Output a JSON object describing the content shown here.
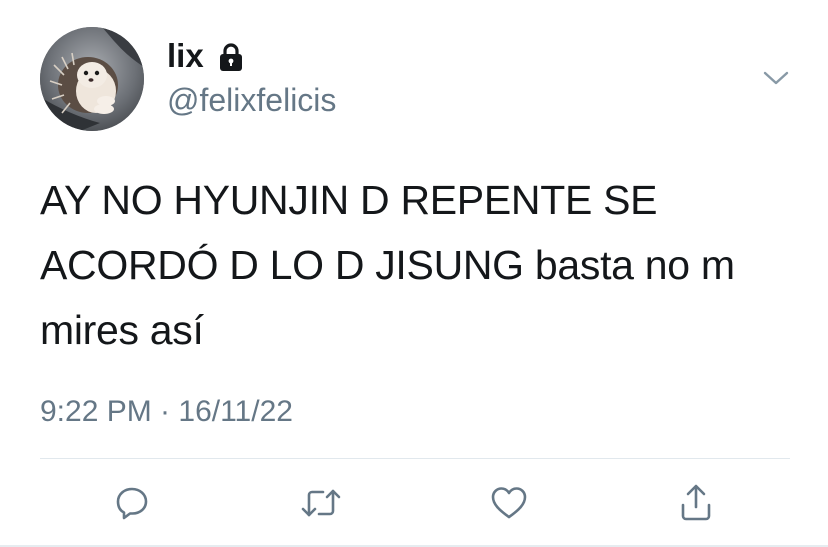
{
  "user": {
    "display_name": "lix",
    "handle": "@felixfelicis",
    "protected_icon": "lock-icon",
    "avatar_icon": "hedgehog-avatar"
  },
  "tweet": {
    "text": "AY NO HYUNJIN D REPENTE SE ACORDÓ D LO D JISUNG basta no m mires así",
    "timestamp": "9:22 PM · 16/11/22"
  },
  "actions": {
    "reply_icon": "reply-icon",
    "retweet_icon": "retweet-icon",
    "like_icon": "heart-icon",
    "share_icon": "share-icon",
    "more_icon": "chevron-down-icon"
  },
  "colors": {
    "primary_text": "#14171a",
    "secondary_text": "#657786",
    "divider": "#e1e8ed"
  }
}
